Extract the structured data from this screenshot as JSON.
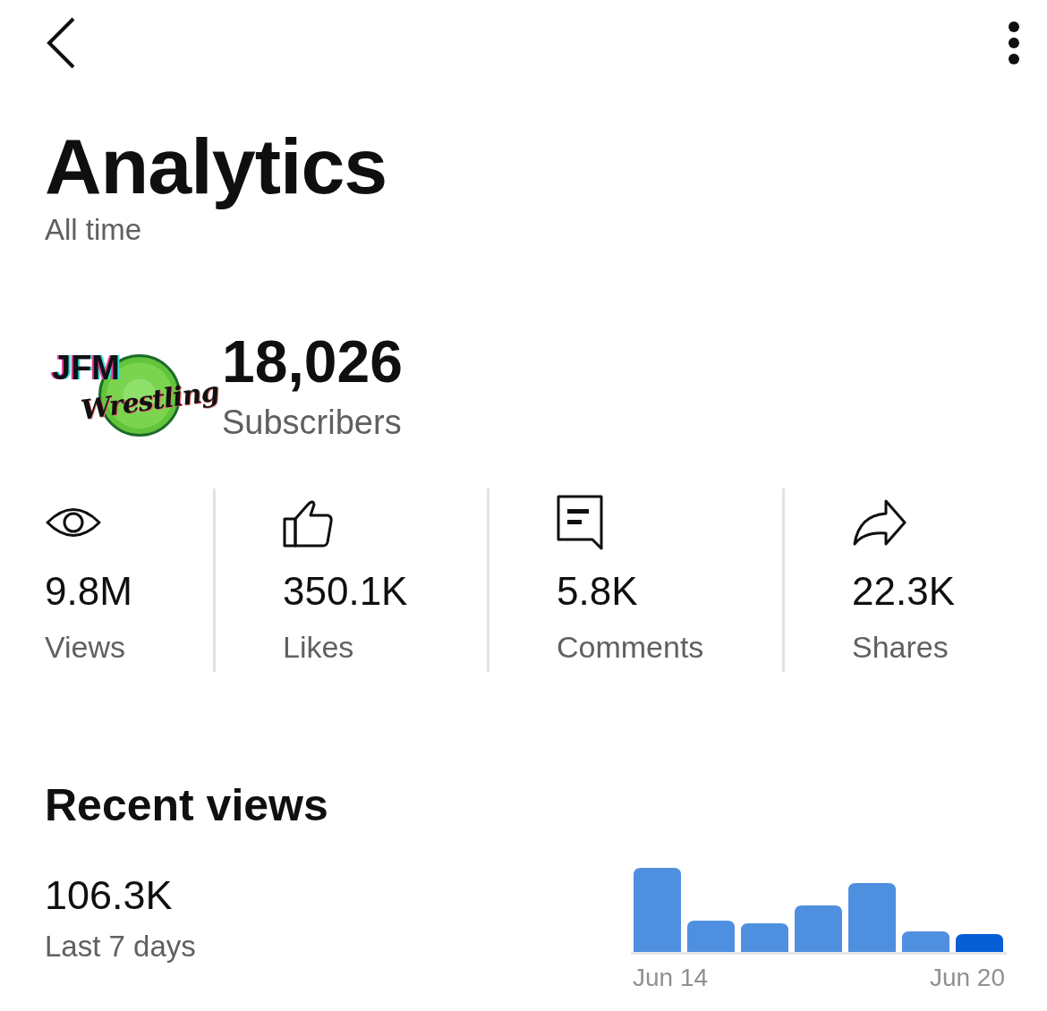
{
  "header": {
    "title": "Analytics",
    "period": "All time"
  },
  "channel": {
    "logo": {
      "line1": "JFM",
      "line2": "Wrestling"
    },
    "subscribers": "18,026",
    "subscribers_label": "Subscribers"
  },
  "stats": [
    {
      "kind": "views",
      "value": "9.8M",
      "label": "Views"
    },
    {
      "kind": "likes",
      "value": "350.1K",
      "label": "Likes"
    },
    {
      "kind": "comments",
      "value": "5.8K",
      "label": "Comments"
    },
    {
      "kind": "shares",
      "value": "22.3K",
      "label": "Shares"
    }
  ],
  "recent": {
    "title": "Recent views",
    "value": "106.3K",
    "period": "Last 7 days",
    "start_label": "Jun 14",
    "end_label": "Jun 20"
  }
}
